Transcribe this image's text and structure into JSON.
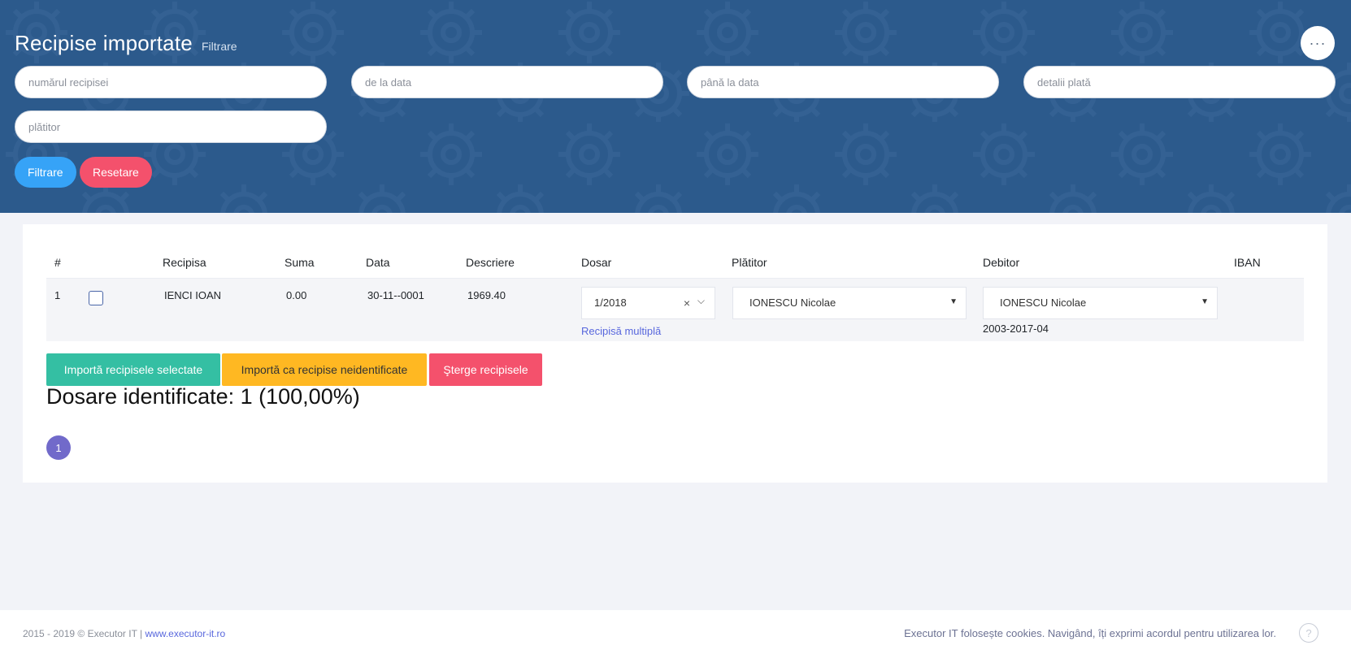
{
  "header": {
    "title": "Recipise importate",
    "subtitle": "Filtrare",
    "more_label": "···",
    "filters": {
      "receipt_number_placeholder": "numărul recipisei",
      "from_date_placeholder": "de la data",
      "to_date_placeholder": "până la data",
      "payment_details_placeholder": "detalii plată",
      "payer_placeholder": "plătitor"
    },
    "filter_button": "Filtrare",
    "reset_button": "Resetare"
  },
  "table": {
    "columns": [
      "#",
      "",
      "Recipisa",
      "Suma",
      "Data",
      "Descriere",
      "Dosar",
      "Plătitor",
      "Debitor",
      "IBAN"
    ],
    "rows": [
      {
        "index": "1",
        "recipisa": "IENCI IOAN",
        "suma": "0.00",
        "data": "30-11--0001",
        "descriere": "1969.40",
        "dosar": "1/2018",
        "dosar_clear": "×",
        "dosar_chevron": "⌵",
        "multi_link": "Recipisă multiplă",
        "platitor": "IONESCU Nicolae",
        "debitor": "IONESCU Nicolae",
        "debitor_code": "2003-2017-04",
        "iban": ""
      }
    ]
  },
  "actions": {
    "import_selected": "Importă recipisele selectate",
    "import_unidentified": "Importă ca recipise neidentificate",
    "delete": "Şterge recipisele"
  },
  "summary": "Dosare identificate: 1 (100,00%)",
  "pagination": {
    "current": "1"
  },
  "footer": {
    "copyright": "2015 - 2019 © Executor IT | ",
    "link": "www.executor-it.ro",
    "cookie_notice": "Executor IT folosește cookies. Navigând, îți exprimi acordul pentru utilizarea lor.",
    "help_label": "?"
  },
  "colors": {
    "banner": "#2c5a8c",
    "primary": "#36a3f7",
    "danger": "#f4516c",
    "success": "#34bfa3",
    "warning": "#ffb822",
    "accent": "#716aca",
    "link": "#5867dd"
  }
}
